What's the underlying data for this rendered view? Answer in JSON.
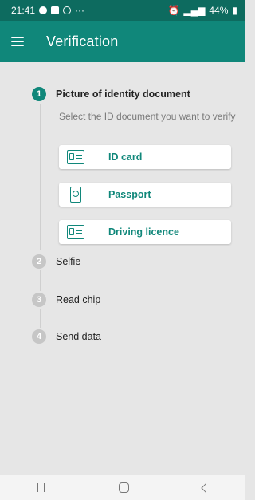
{
  "status_bar": {
    "time": "21:41",
    "left_icons": [
      "chat-bubble-icon",
      "badge-icon",
      "check-circle-icon"
    ],
    "more": "···",
    "battery": "44%"
  },
  "app_bar": {
    "title": "Verification"
  },
  "steps": [
    {
      "number": "1",
      "label": "Picture of identity document",
      "state": "active"
    },
    {
      "number": "2",
      "label": "Selfie",
      "state": "inactive"
    },
    {
      "number": "3",
      "label": "Read chip",
      "state": "inactive"
    },
    {
      "number": "4",
      "label": "Send data",
      "state": "inactive"
    }
  ],
  "step1": {
    "description": "Select the ID document you want to verify",
    "documents": [
      {
        "label": "ID card",
        "icon": "id-card-icon"
      },
      {
        "label": "Passport",
        "icon": "passport-icon"
      },
      {
        "label": "Driving licence",
        "icon": "driving-licence-icon"
      }
    ]
  },
  "colors": {
    "status_bar": "#0d6b5f",
    "app_bar": "#10877a",
    "accent": "#10877a",
    "background": "#e6e6e6",
    "inactive_step": "#c6c6c6"
  }
}
